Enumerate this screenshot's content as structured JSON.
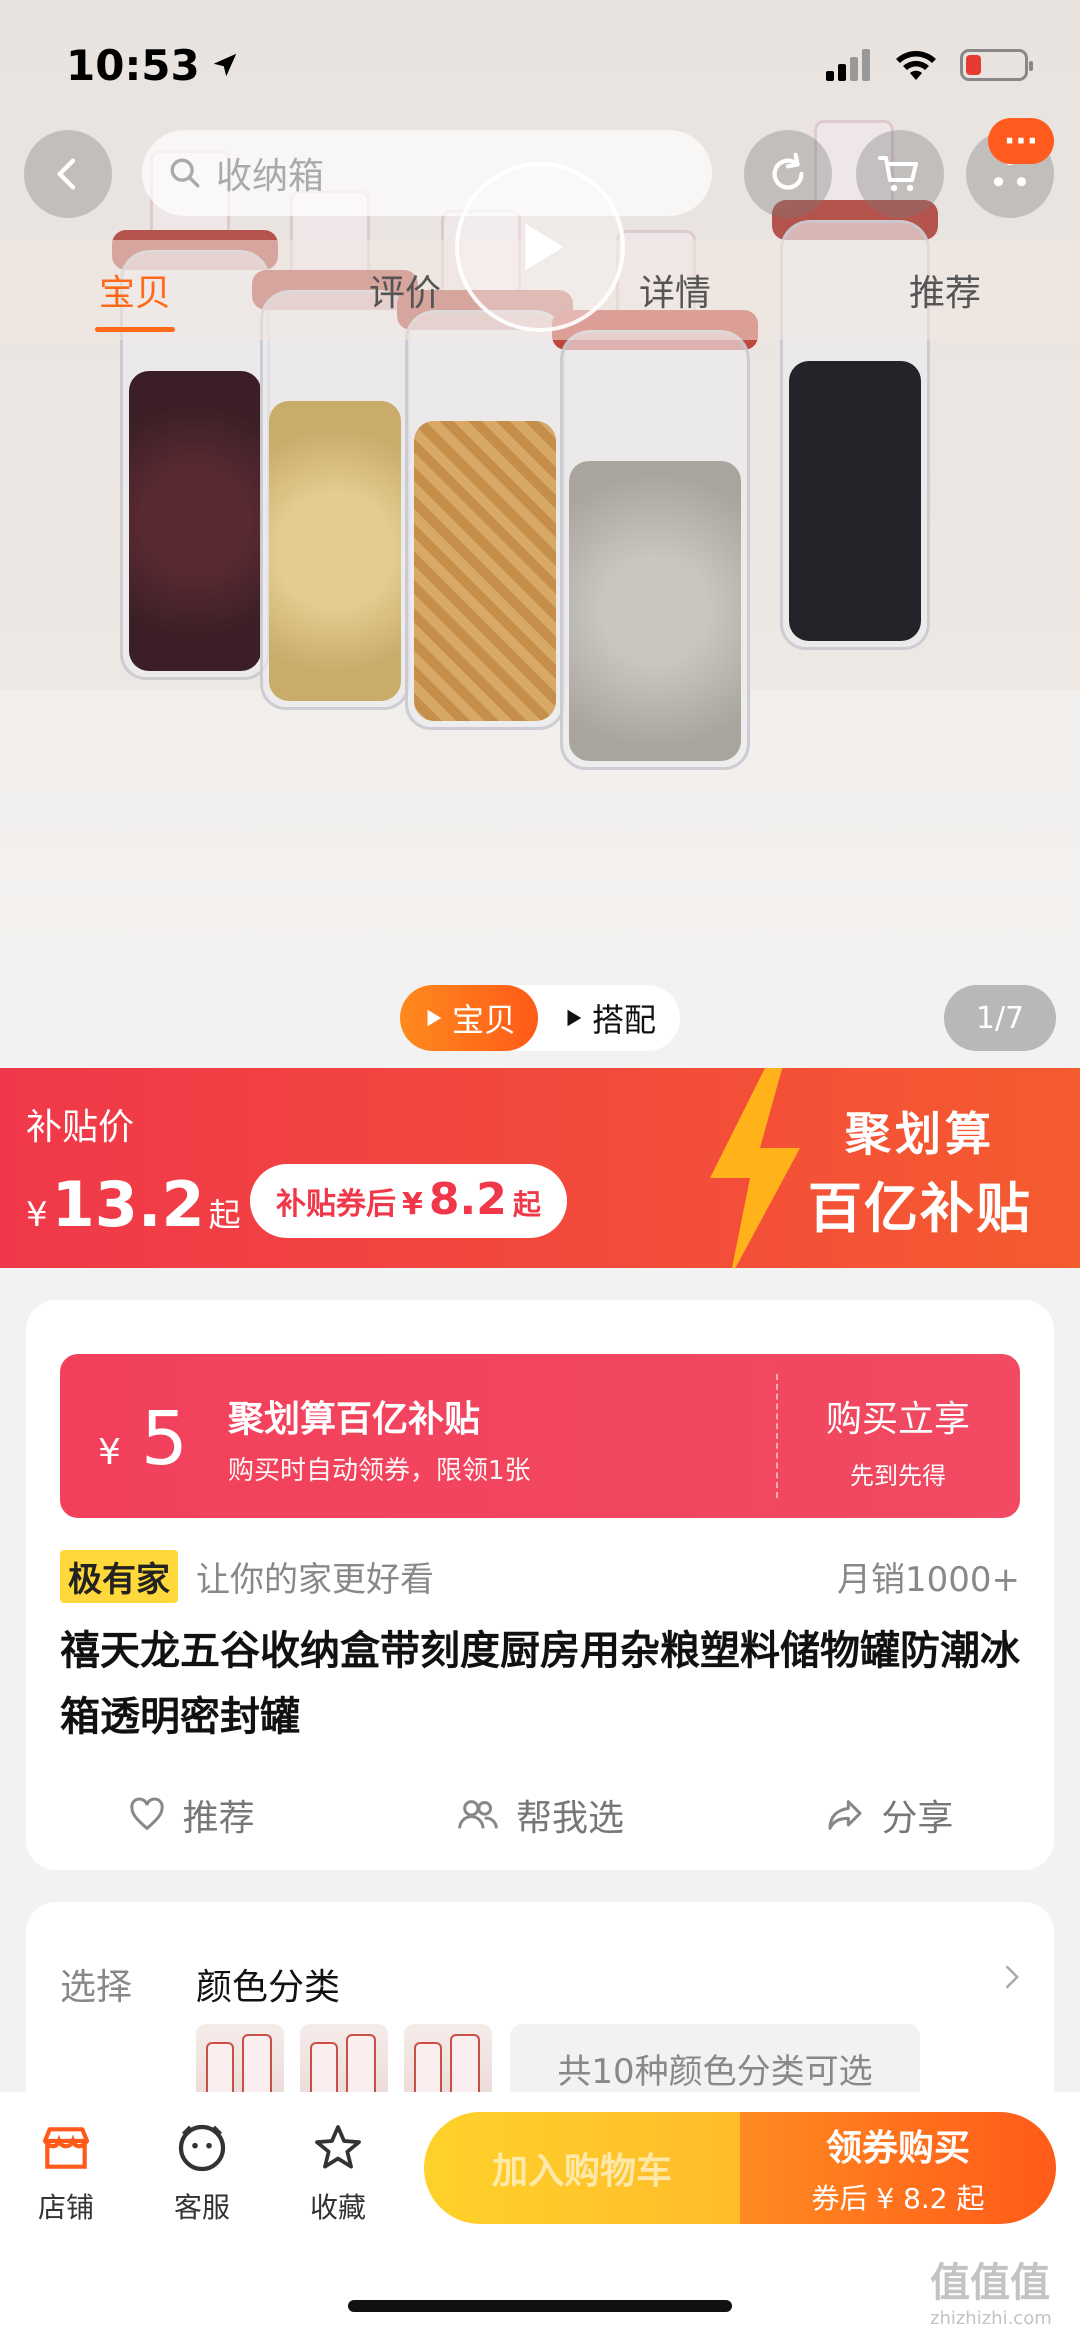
{
  "status": {
    "time": "10:53"
  },
  "nav": {
    "search_placeholder": "收纳箱",
    "badge": "···",
    "tabs": [
      {
        "label": "宝贝",
        "active": true
      },
      {
        "label": "评价",
        "active": false
      },
      {
        "label": "详情",
        "active": false
      },
      {
        "label": "推荐",
        "active": false
      }
    ]
  },
  "media": {
    "segments": [
      {
        "label": "宝贝",
        "active": true
      },
      {
        "label": "搭配",
        "active": false
      }
    ],
    "page_indicator": "1/7"
  },
  "price_banner": {
    "label": "补贴价",
    "currency": "¥",
    "price": "13.2",
    "price_suffix": "起",
    "coupon_text": "补贴券后",
    "coupon_currency": "¥",
    "coupon_price": "8.2",
    "coupon_suffix": "起",
    "logo_line1": "聚划算",
    "logo_line2": "百亿补贴"
  },
  "subsidy_coupon": {
    "currency": "¥",
    "amount": "5",
    "title": "聚划算百亿补贴",
    "desc": "购买时自动领券，限领1张",
    "action": "购买立享",
    "action_sub": "先到先得"
  },
  "product": {
    "brand_tag": "极有家",
    "slogan": "让你的家更好看",
    "monthly_sales": "月销1000+",
    "title": "禧天龙五谷收纳盒带刻度厨房用杂粮塑料储物罐防潮冰箱透明密封罐",
    "actions": [
      {
        "label": "推荐",
        "icon": "heart-icon"
      },
      {
        "label": "帮我选",
        "icon": "people-icon"
      },
      {
        "label": "分享",
        "icon": "share-icon"
      }
    ]
  },
  "select": {
    "label": "选择",
    "title": "颜色分类",
    "variant_summary": "共10种颜色分类可选"
  },
  "bottom_bar": {
    "items": [
      {
        "label": "店铺",
        "icon": "store-icon"
      },
      {
        "label": "客服",
        "icon": "service-icon"
      },
      {
        "label": "收藏",
        "icon": "star-icon"
      }
    ],
    "add_to_cart": "加入购物车",
    "buy_label": "领券购买",
    "buy_sub": "券后 ¥ 8.2 起"
  },
  "watermark": {
    "text": "值值值",
    "site": "zhizhizhi.com"
  },
  "colors": {
    "accent_orange": "#ff6a1a",
    "banner_red": "#f0384a",
    "coupon_red": "#f2405b",
    "brand_yellow": "#ffd83c"
  }
}
